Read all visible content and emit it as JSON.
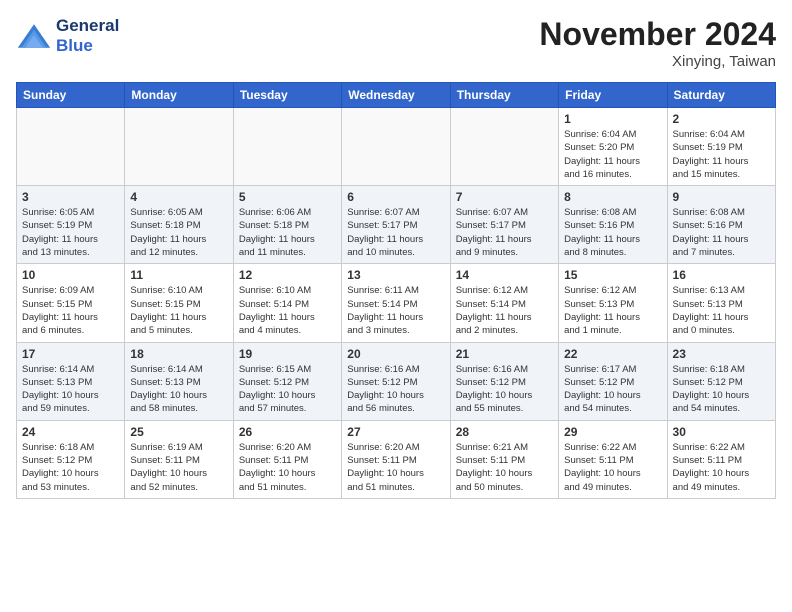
{
  "header": {
    "logo_line1": "General",
    "logo_line2": "Blue",
    "month": "November 2024",
    "location": "Xinying, Taiwan"
  },
  "weekdays": [
    "Sunday",
    "Monday",
    "Tuesday",
    "Wednesday",
    "Thursday",
    "Friday",
    "Saturday"
  ],
  "weeks": [
    [
      {
        "day": "",
        "info": ""
      },
      {
        "day": "",
        "info": ""
      },
      {
        "day": "",
        "info": ""
      },
      {
        "day": "",
        "info": ""
      },
      {
        "day": "",
        "info": ""
      },
      {
        "day": "1",
        "info": "Sunrise: 6:04 AM\nSunset: 5:20 PM\nDaylight: 11 hours\nand 16 minutes."
      },
      {
        "day": "2",
        "info": "Sunrise: 6:04 AM\nSunset: 5:19 PM\nDaylight: 11 hours\nand 15 minutes."
      }
    ],
    [
      {
        "day": "3",
        "info": "Sunrise: 6:05 AM\nSunset: 5:19 PM\nDaylight: 11 hours\nand 13 minutes."
      },
      {
        "day": "4",
        "info": "Sunrise: 6:05 AM\nSunset: 5:18 PM\nDaylight: 11 hours\nand 12 minutes."
      },
      {
        "day": "5",
        "info": "Sunrise: 6:06 AM\nSunset: 5:18 PM\nDaylight: 11 hours\nand 11 minutes."
      },
      {
        "day": "6",
        "info": "Sunrise: 6:07 AM\nSunset: 5:17 PM\nDaylight: 11 hours\nand 10 minutes."
      },
      {
        "day": "7",
        "info": "Sunrise: 6:07 AM\nSunset: 5:17 PM\nDaylight: 11 hours\nand 9 minutes."
      },
      {
        "day": "8",
        "info": "Sunrise: 6:08 AM\nSunset: 5:16 PM\nDaylight: 11 hours\nand 8 minutes."
      },
      {
        "day": "9",
        "info": "Sunrise: 6:08 AM\nSunset: 5:16 PM\nDaylight: 11 hours\nand 7 minutes."
      }
    ],
    [
      {
        "day": "10",
        "info": "Sunrise: 6:09 AM\nSunset: 5:15 PM\nDaylight: 11 hours\nand 6 minutes."
      },
      {
        "day": "11",
        "info": "Sunrise: 6:10 AM\nSunset: 5:15 PM\nDaylight: 11 hours\nand 5 minutes."
      },
      {
        "day": "12",
        "info": "Sunrise: 6:10 AM\nSunset: 5:14 PM\nDaylight: 11 hours\nand 4 minutes."
      },
      {
        "day": "13",
        "info": "Sunrise: 6:11 AM\nSunset: 5:14 PM\nDaylight: 11 hours\nand 3 minutes."
      },
      {
        "day": "14",
        "info": "Sunrise: 6:12 AM\nSunset: 5:14 PM\nDaylight: 11 hours\nand 2 minutes."
      },
      {
        "day": "15",
        "info": "Sunrise: 6:12 AM\nSunset: 5:13 PM\nDaylight: 11 hours\nand 1 minute."
      },
      {
        "day": "16",
        "info": "Sunrise: 6:13 AM\nSunset: 5:13 PM\nDaylight: 11 hours\nand 0 minutes."
      }
    ],
    [
      {
        "day": "17",
        "info": "Sunrise: 6:14 AM\nSunset: 5:13 PM\nDaylight: 10 hours\nand 59 minutes."
      },
      {
        "day": "18",
        "info": "Sunrise: 6:14 AM\nSunset: 5:13 PM\nDaylight: 10 hours\nand 58 minutes."
      },
      {
        "day": "19",
        "info": "Sunrise: 6:15 AM\nSunset: 5:12 PM\nDaylight: 10 hours\nand 57 minutes."
      },
      {
        "day": "20",
        "info": "Sunrise: 6:16 AM\nSunset: 5:12 PM\nDaylight: 10 hours\nand 56 minutes."
      },
      {
        "day": "21",
        "info": "Sunrise: 6:16 AM\nSunset: 5:12 PM\nDaylight: 10 hours\nand 55 minutes."
      },
      {
        "day": "22",
        "info": "Sunrise: 6:17 AM\nSunset: 5:12 PM\nDaylight: 10 hours\nand 54 minutes."
      },
      {
        "day": "23",
        "info": "Sunrise: 6:18 AM\nSunset: 5:12 PM\nDaylight: 10 hours\nand 54 minutes."
      }
    ],
    [
      {
        "day": "24",
        "info": "Sunrise: 6:18 AM\nSunset: 5:12 PM\nDaylight: 10 hours\nand 53 minutes."
      },
      {
        "day": "25",
        "info": "Sunrise: 6:19 AM\nSunset: 5:11 PM\nDaylight: 10 hours\nand 52 minutes."
      },
      {
        "day": "26",
        "info": "Sunrise: 6:20 AM\nSunset: 5:11 PM\nDaylight: 10 hours\nand 51 minutes."
      },
      {
        "day": "27",
        "info": "Sunrise: 6:20 AM\nSunset: 5:11 PM\nDaylight: 10 hours\nand 51 minutes."
      },
      {
        "day": "28",
        "info": "Sunrise: 6:21 AM\nSunset: 5:11 PM\nDaylight: 10 hours\nand 50 minutes."
      },
      {
        "day": "29",
        "info": "Sunrise: 6:22 AM\nSunset: 5:11 PM\nDaylight: 10 hours\nand 49 minutes."
      },
      {
        "day": "30",
        "info": "Sunrise: 6:22 AM\nSunset: 5:11 PM\nDaylight: 10 hours\nand 49 minutes."
      }
    ]
  ]
}
